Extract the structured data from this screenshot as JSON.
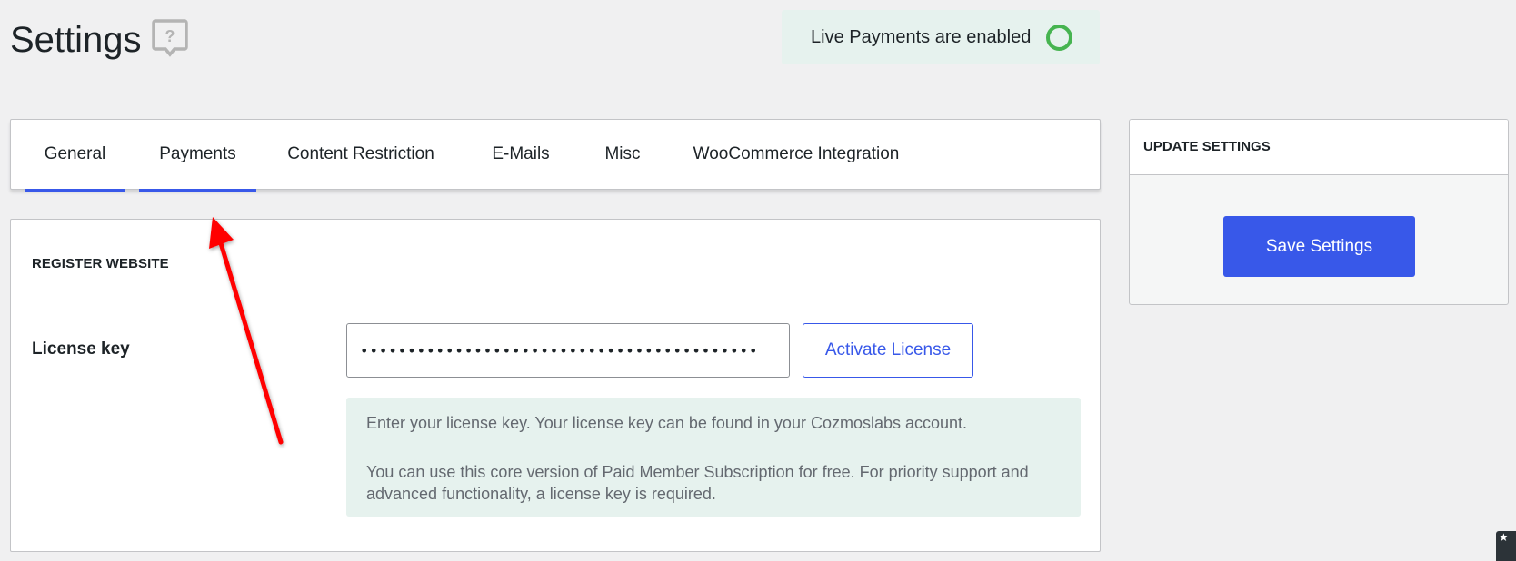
{
  "header": {
    "title": "Settings",
    "help_icon": "help-speech-bubble-icon",
    "live_status": {
      "text": "Live Payments are enabled",
      "icon": "status-circle-icon",
      "color": "#46b450"
    }
  },
  "tabs": [
    {
      "label": "General",
      "active": true
    },
    {
      "label": "Payments",
      "active": true
    },
    {
      "label": "Content Restriction",
      "active": false
    },
    {
      "label": "E-Mails",
      "active": false
    },
    {
      "label": "Misc",
      "active": false
    },
    {
      "label": "WooCommerce Integration",
      "active": false
    }
  ],
  "register": {
    "section_title": "REGISTER WEBSITE",
    "license_label": "License key",
    "license_value": "••••••••••••••••••••••••••••••••••••••••••",
    "activate_label": "Activate License",
    "info_lines": [
      "Enter your license key. Your license key can be found in your Cozmoslabs account.",
      "You can use this core version of Paid Member Subscription for free. For priority support and advanced functionality, a license key is required."
    ]
  },
  "sidebar": {
    "title": "UPDATE SETTINGS",
    "save_label": "Save Settings"
  },
  "annotation": {
    "arrow_color": "#ff0000",
    "pointing_to": "Payments tab"
  },
  "colors": {
    "accent": "#3858e9",
    "notice_bg": "#e6f2ee",
    "page_bg": "#f0f0f1"
  }
}
